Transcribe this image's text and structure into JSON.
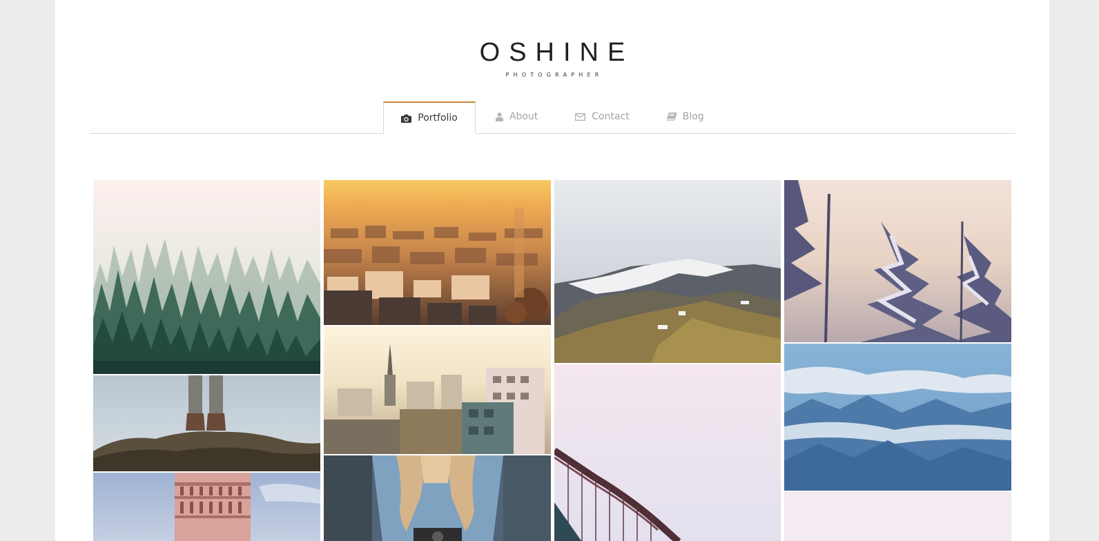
{
  "brand": {
    "title": "OSHINE",
    "subtitle": "PHOTOGRAPHER"
  },
  "nav": {
    "items": [
      {
        "label": "Portfolio",
        "icon": "camera-icon",
        "active": true
      },
      {
        "label": "About",
        "icon": "user-icon",
        "active": false
      },
      {
        "label": "Contact",
        "icon": "envelope-icon",
        "active": false
      },
      {
        "label": "Blog",
        "icon": "book-icon",
        "active": false
      }
    ]
  },
  "portfolio": {
    "items": [
      {
        "subject": "misty pine forest"
      },
      {
        "subject": "city at sunset"
      },
      {
        "subject": "snowy mountain peak"
      },
      {
        "subject": "snow covered trees"
      },
      {
        "subject": "boots on rocky edge"
      },
      {
        "subject": "town with church spire"
      },
      {
        "subject": "mountains above clouds"
      },
      {
        "subject": "bridge against pink sky"
      },
      {
        "subject": "leaning tower"
      },
      {
        "subject": "woman holding camera"
      },
      {
        "subject": "pale pink sky"
      }
    ]
  },
  "colors": {
    "accent": "#c7883e",
    "nav_inactive": "#a3a3a3",
    "nav_active": "#3a3a3a",
    "background": "#ececec"
  }
}
